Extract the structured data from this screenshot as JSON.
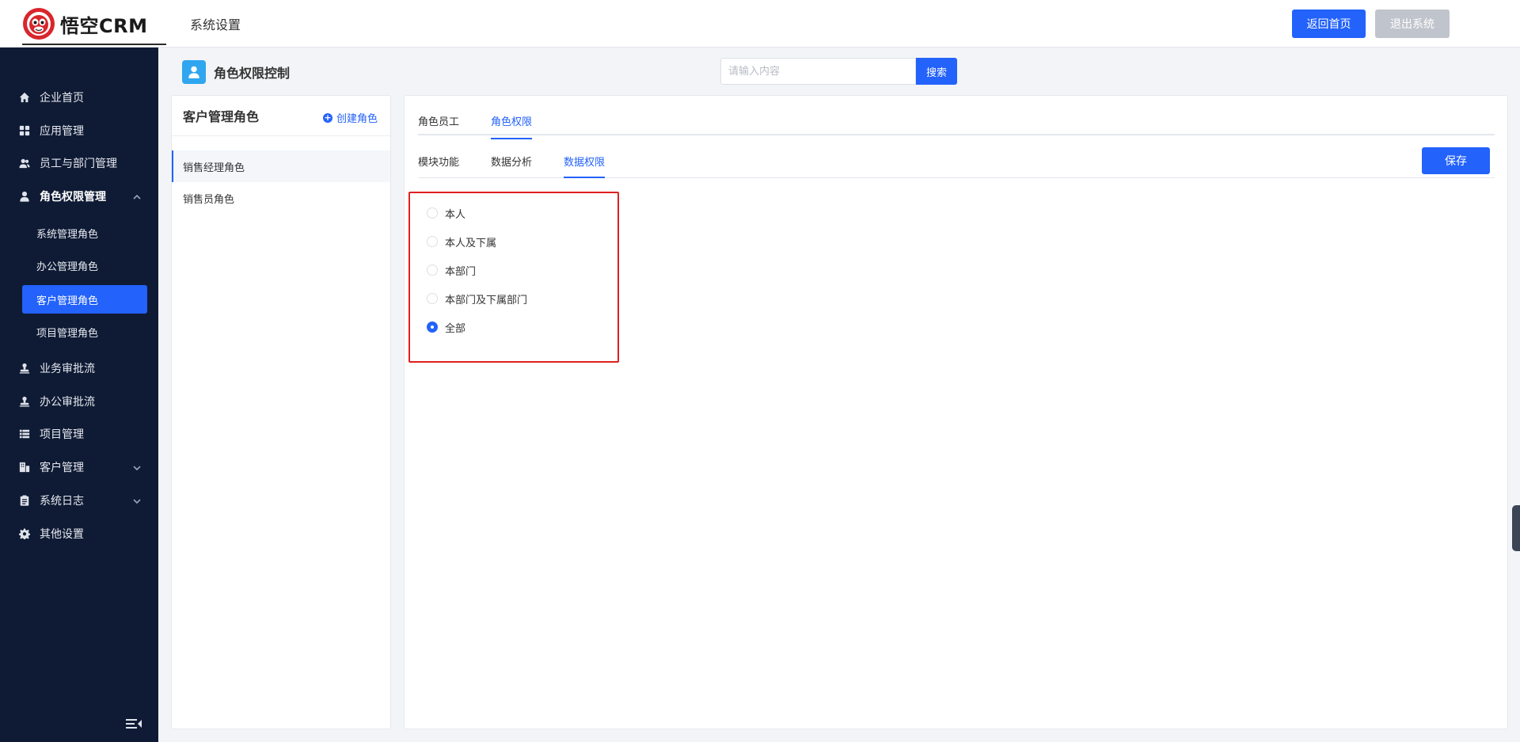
{
  "header": {
    "logo_text": "悟空CRM",
    "module_title": "系统设置",
    "home_button": "返回首页",
    "logout_button": "退出系统"
  },
  "sidebar": {
    "items": [
      {
        "label": "企业首页",
        "icon": "home-icon"
      },
      {
        "label": "应用管理",
        "icon": "grid-icon"
      },
      {
        "label": "员工与部门管理",
        "icon": "users-icon"
      },
      {
        "label": "角色权限管理",
        "icon": "user-icon",
        "expanded": true
      },
      {
        "label": "业务审批流",
        "icon": "stamp-icon"
      },
      {
        "label": "办公审批流",
        "icon": "stamp-icon"
      },
      {
        "label": "项目管理",
        "icon": "list-icon"
      },
      {
        "label": "客户管理",
        "icon": "building-icon"
      },
      {
        "label": "系统日志",
        "icon": "clipboard-icon"
      },
      {
        "label": "其他设置",
        "icon": "gear-icon"
      }
    ],
    "sub_items": [
      {
        "label": "系统管理角色"
      },
      {
        "label": "办公管理角色"
      },
      {
        "label": "客户管理角色",
        "active": true
      },
      {
        "label": "项目管理角色"
      }
    ]
  },
  "page": {
    "title": "角色权限控制",
    "search_placeholder": "请输入内容",
    "search_button": "搜索"
  },
  "role_panel": {
    "title": "客户管理角色",
    "create_label": "创建角色",
    "roles": [
      {
        "label": "销售经理角色",
        "selected": true
      },
      {
        "label": "销售员角色"
      }
    ]
  },
  "permission_panel": {
    "tabs": [
      {
        "label": "角色员工"
      },
      {
        "label": "角色权限",
        "active": true
      }
    ],
    "sub_tabs": [
      {
        "label": "模块功能"
      },
      {
        "label": "数据分析"
      },
      {
        "label": "数据权限",
        "active": true
      }
    ],
    "save_button": "保存",
    "data_scope_options": [
      {
        "label": "本人",
        "checked": false
      },
      {
        "label": "本人及下属",
        "checked": false
      },
      {
        "label": "本部门",
        "checked": false
      },
      {
        "label": "本部门及下属部门",
        "checked": false
      },
      {
        "label": "全部",
        "checked": true
      }
    ],
    "highlight_color": "#e02020"
  },
  "colors": {
    "primary": "#2362fb",
    "sidebar_bg": "#0f1b35",
    "disabled_button": "#c0c4cc"
  }
}
